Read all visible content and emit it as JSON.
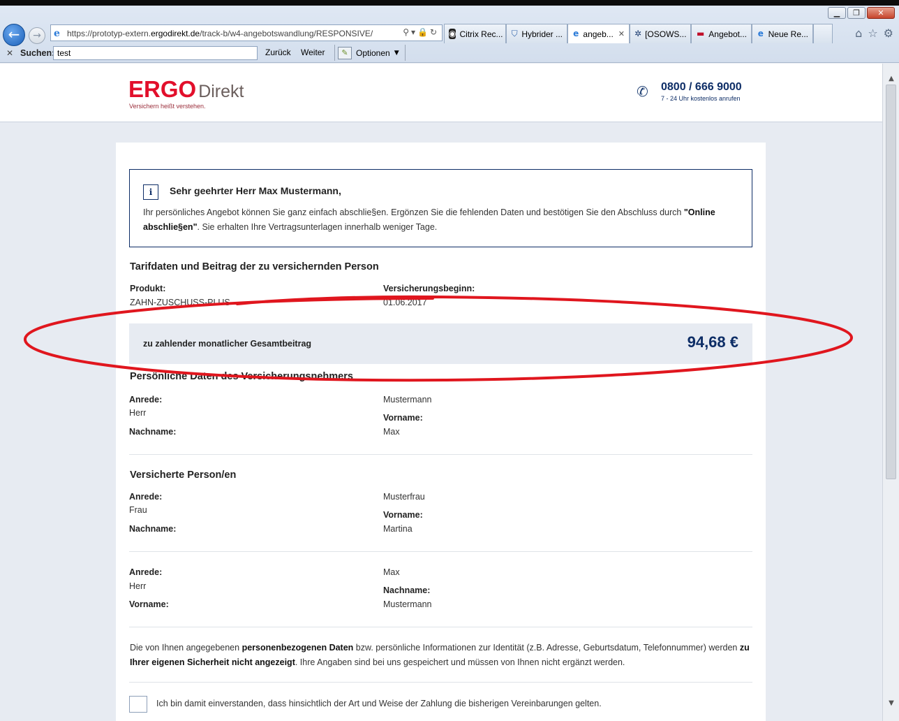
{
  "browser": {
    "url_prefix": "https://prototyp-extern.",
    "url_domain": "ergodirekt.de",
    "url_path": "/track-b/w4-angebotswandlung/RESPONSIVE/",
    "tabs": [
      {
        "label": "Citrix Rec...",
        "icon": "citrix-icon",
        "active": false
      },
      {
        "label": "Hybrider ...",
        "icon": "shield-icon",
        "active": false
      },
      {
        "label": "angeb...",
        "icon": "ie-icon",
        "active": true
      },
      {
        "label": "[OSOWS...",
        "icon": "network-icon",
        "active": false
      },
      {
        "label": "Angebot...",
        "icon": "flag-icon",
        "active": false
      },
      {
        "label": "Neue Re...",
        "icon": "ie-icon",
        "active": false
      }
    ],
    "find": {
      "label": "Suchen:",
      "value": "test",
      "back": "Zurück",
      "next": "Weiter",
      "options": "Optionen"
    }
  },
  "header": {
    "logo_main": "ERGO",
    "logo_sub": "Direkt",
    "tagline": "Versichern heißt verstehen.",
    "phone": "0800 / 666 9000",
    "phone_hint": "7 - 24 Uhr kostenlos anrufen"
  },
  "info": {
    "greeting": "Sehr geehrter Herr Max Mustermann,",
    "text_1": "Ihr persönliches Angebot können Sie ganz einfach abschlie§en. Ergönzen Sie die fehlenden Daten und bestötigen Sie den Abschluss durch ",
    "text_bold": "\"Online abschlie§en\"",
    "text_2": ". Sie erhalten Ihre Vertragsunterlagen innerhalb weniger Tage."
  },
  "tarif": {
    "title": "Tarifdaten und Beitrag der zu versichernden Person",
    "product_label": "Produkt:",
    "product_value": "ZAHN-ZUSCHUSS-PLUS",
    "start_label": "Versicherungsbeginn:",
    "start_value": "01.06.2017",
    "total_label": "zu zahlender monatlicher Gesamtbeitrag",
    "total_value": "94,68 €"
  },
  "holder": {
    "title": "Persönliche Daten des Versicherungsnehmers",
    "anrede_label": "Anrede:",
    "anrede_value": "Herr",
    "nachname_label": "Nachname:",
    "col2_top": "Mustermann",
    "vorname_label": "Vorname:",
    "vorname_value": "Max"
  },
  "insured": {
    "title": "Versicherte Person/en",
    "p1": {
      "anrede_label": "Anrede:",
      "anrede_value": "Frau",
      "nachname_label": "Nachname:",
      "col2_top": "Musterfrau",
      "vorname_label": "Vorname:",
      "vorname_value": "Martina"
    },
    "p2": {
      "anrede_label": "Anrede:",
      "anrede_value": "Herr",
      "vorname_label": "Vorname:",
      "col2_top": "Max",
      "nachname_label": "Nachname:",
      "nachname_value": "Mustermann"
    }
  },
  "privacy": {
    "t1": "Die von Ihnen angegebenen ",
    "b1": "personenbezogenen Daten",
    "t2": " bzw. persönliche Informationen zur Identität (z.B. Adresse, Geburtsdatum, Telefonnummer) werden ",
    "b2": "zu Ihrer eigenen Sicherheit nicht angezeigt",
    "t3": ". Ihre Angaben sind bei uns gespeichert und müssen von Ihnen nicht ergänzt werden."
  },
  "consent": {
    "label": "Ich bin damit einverstanden, dass hinsichtlich der Art und Weise der Zahlung die bisherigen Vereinbarungen gelten.",
    "checked": false
  },
  "annotation_color": "#e0161e",
  "brand_red": "#e20f2b",
  "brand_navy": "#0d2d66"
}
